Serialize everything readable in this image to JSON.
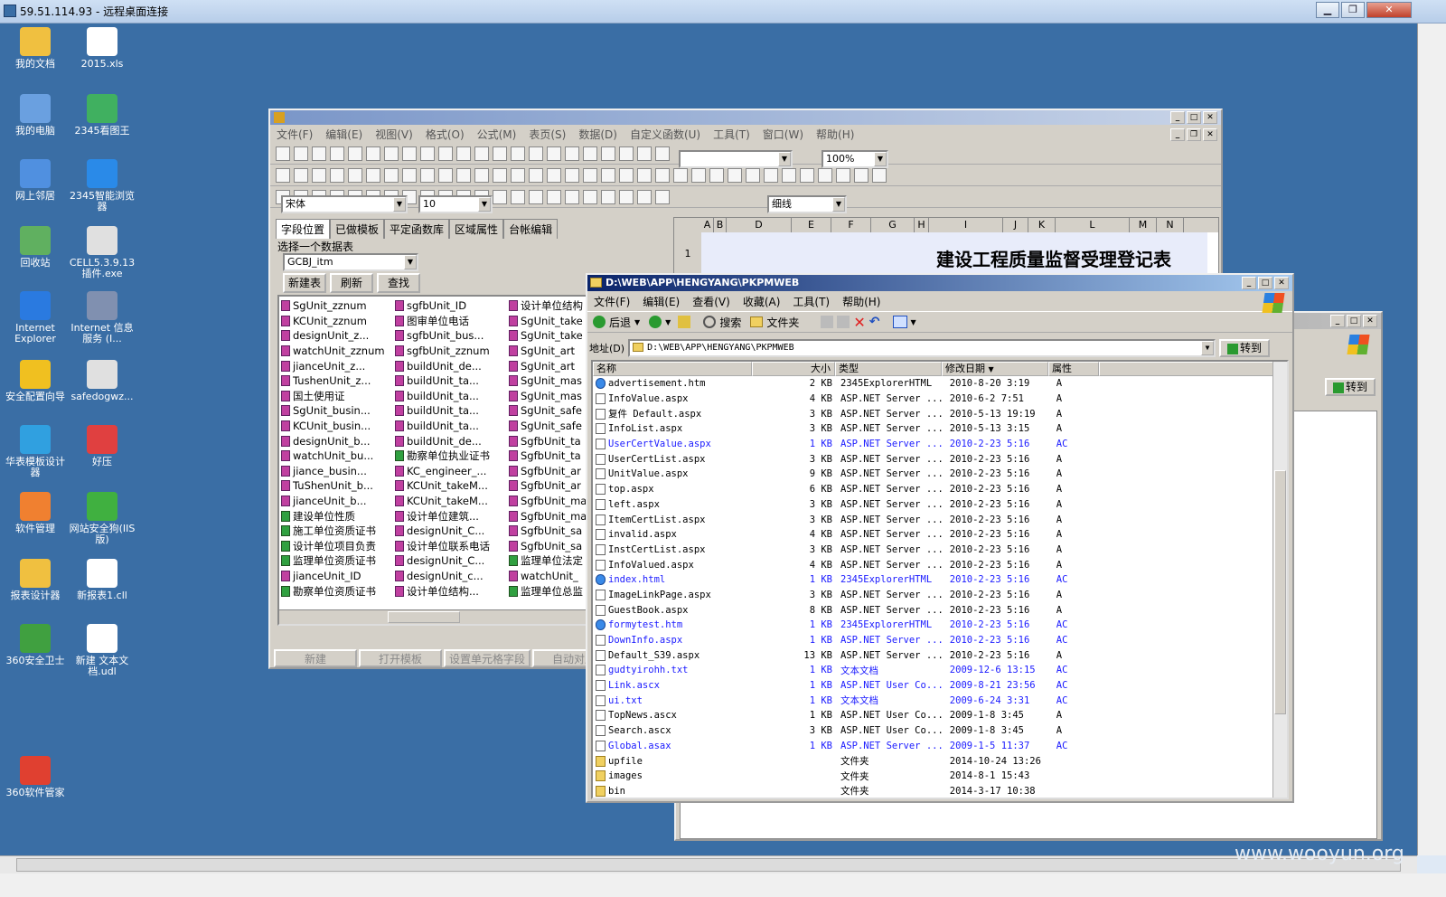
{
  "title_bar": {
    "text": "59.51.114.93 - 远程桌面连接"
  },
  "watermark": "www.wooyun.org",
  "desktop_icons": [
    {
      "label": "我的文档"
    },
    {
      "label": "2015.xls"
    },
    {
      "label": "我的电脑"
    },
    {
      "label": "2345看图王"
    },
    {
      "label": "网上邻居"
    },
    {
      "label": "2345智能浏览器"
    },
    {
      "label": "回收站"
    },
    {
      "label": "CELL5.3.9.13插件.exe"
    },
    {
      "label": "Internet Explorer"
    },
    {
      "label": "Internet 信息服务 (I..."
    },
    {
      "label": "安全配置向导"
    },
    {
      "label": "safedogwz..."
    },
    {
      "label": "华表模板设计器"
    },
    {
      "label": "好压"
    },
    {
      "label": "软件管理"
    },
    {
      "label": "网站安全狗(IIS版)"
    },
    {
      "label": "报表设计器"
    },
    {
      "label": "新报表1.cll"
    },
    {
      "label": "360安全卫士"
    },
    {
      "label": "新建 文本文档.udl"
    },
    {
      "label": "360软件管家"
    }
  ],
  "designer": {
    "menu": [
      "文件(F)",
      "编辑(E)",
      "视图(V)",
      "格式(O)",
      "公式(M)",
      "表页(S)",
      "数据(D)",
      "自定义函数(U)",
      "工具(T)",
      "窗口(W)",
      "帮助(H)"
    ],
    "zoom": "100%",
    "font_name": "宋体",
    "font_size": "10",
    "line_style": "细线",
    "tabs": [
      "字段位置",
      "已做模板",
      "平定函数库",
      "区域属性",
      "台帐编辑"
    ],
    "select_label": "选择一个数据表",
    "table_select": "GCBJ_itm",
    "buttons": {
      "new_table": "新建表",
      "refresh": "刷新",
      "find": "查找"
    },
    "col_headers": [
      "A",
      "B",
      "D",
      "E",
      "F",
      "G",
      "H",
      "I",
      "J",
      "K",
      "L",
      "M",
      "N"
    ],
    "row1": "1",
    "sheet_title": "建设工程质量监督受理登记表",
    "bottom_buttons": [
      "新建",
      "打开模板",
      "设置单元格字段",
      "自动对应"
    ],
    "fields_col1": [
      "SgUnit_zznum",
      "KCUnit_zznum",
      "designUnit_z...",
      "watchUnit_zznum",
      "jianceUnit_z...",
      "TushenUnit_z...",
      "国土使用证",
      "SgUnit_busin...",
      "KCUnit_busin...",
      "designUnit_b...",
      "watchUnit_bu...",
      "jiance_busin...",
      "TuShenUnit_b...",
      "jianceUnit_b...",
      "建设单位性质",
      "施工单位资质证书",
      "设计单位项目负责",
      "监理单位资质证书",
      "jianceUnit_ID",
      "勘察单位资质证书"
    ],
    "fields_col2": [
      "sgfbUnit_ID",
      "图审单位电话",
      "sgfbUnit_bus...",
      "sgfbUnit_zznum",
      "buildUnit_de...",
      "buildUnit_ta...",
      "buildUnit_ta...",
      "buildUnit_ta...",
      "buildUnit_ta...",
      "buildUnit_de...",
      "勘察单位执业证书",
      "KC_engineer_...",
      "KCUnit_takeM...",
      "KCUnit_takeM...",
      "设计单位建筑...",
      "designUnit_C...",
      "设计单位联系电话",
      "designUnit_C...",
      "designUnit_c...",
      "设计单位结构..."
    ],
    "fields_col3": [
      "设计单位结构",
      "SgUnit_take",
      "SgUnit_take",
      "SgUnit_art",
      "SgUnit_art",
      "SgUnit_mas",
      "SgUnit_mas",
      "SgUnit_safe",
      "SgUnit_safe",
      "SgfbUnit_ta",
      "SgfbUnit_ta",
      "SgfbUnit_ar",
      "SgfbUnit_ar",
      "SgfbUnit_ma",
      "SgfbUnit_ma",
      "SgfbUnit_sa",
      "SgfbUnit_sa",
      "监理单位法定",
      "watchUnit_",
      "监理单位总监"
    ]
  },
  "explorer": {
    "title": "D:\\WEB\\APP\\HENGYANG\\PKPMWEB",
    "menu": [
      "文件(F)",
      "编辑(E)",
      "查看(V)",
      "收藏(A)",
      "工具(T)",
      "帮助(H)"
    ],
    "back": "后退",
    "search": "搜索",
    "folders": "文件夹",
    "address_label": "地址(D)",
    "address": "D:\\WEB\\APP\\HENGYANG\\PKPMWEB",
    "go": "转到",
    "columns": [
      "名称",
      "大小",
      "类型",
      "修改日期",
      "属性"
    ],
    "files": [
      {
        "name": "advertisement.htm",
        "size": "2 KB",
        "type": "2345ExplorerHTML",
        "date": "2010-8-20 3:19",
        "attr": "A",
        "blue": false,
        "icon": "web"
      },
      {
        "name": "InfoValue.aspx",
        "size": "4 KB",
        "type": "ASP.NET Server ...",
        "date": "2010-6-2 7:51",
        "attr": "A",
        "blue": false,
        "icon": "doc"
      },
      {
        "name": "复件 Default.aspx",
        "size": "3 KB",
        "type": "ASP.NET Server ...",
        "date": "2010-5-13 19:19",
        "attr": "A",
        "blue": false,
        "icon": "doc"
      },
      {
        "name": "InfoList.aspx",
        "size": "3 KB",
        "type": "ASP.NET Server ...",
        "date": "2010-5-13 3:15",
        "attr": "A",
        "blue": false,
        "icon": "doc"
      },
      {
        "name": "UserCertValue.aspx",
        "size": "1 KB",
        "type": "ASP.NET Server ...",
        "date": "2010-2-23 5:16",
        "attr": "AC",
        "blue": true,
        "icon": "doc"
      },
      {
        "name": "UserCertList.aspx",
        "size": "3 KB",
        "type": "ASP.NET Server ...",
        "date": "2010-2-23 5:16",
        "attr": "A",
        "blue": false,
        "icon": "doc"
      },
      {
        "name": "UnitValue.aspx",
        "size": "9 KB",
        "type": "ASP.NET Server ...",
        "date": "2010-2-23 5:16",
        "attr": "A",
        "blue": false,
        "icon": "doc"
      },
      {
        "name": "top.aspx",
        "size": "6 KB",
        "type": "ASP.NET Server ...",
        "date": "2010-2-23 5:16",
        "attr": "A",
        "blue": false,
        "icon": "doc"
      },
      {
        "name": "left.aspx",
        "size": "3 KB",
        "type": "ASP.NET Server ...",
        "date": "2010-2-23 5:16",
        "attr": "A",
        "blue": false,
        "icon": "doc"
      },
      {
        "name": "ItemCertList.aspx",
        "size": "3 KB",
        "type": "ASP.NET Server ...",
        "date": "2010-2-23 5:16",
        "attr": "A",
        "blue": false,
        "icon": "doc"
      },
      {
        "name": "invalid.aspx",
        "size": "4 KB",
        "type": "ASP.NET Server ...",
        "date": "2010-2-23 5:16",
        "attr": "A",
        "blue": false,
        "icon": "doc"
      },
      {
        "name": "InstCertList.aspx",
        "size": "3 KB",
        "type": "ASP.NET Server ...",
        "date": "2010-2-23 5:16",
        "attr": "A",
        "blue": false,
        "icon": "doc"
      },
      {
        "name": "InfoValued.aspx",
        "size": "4 KB",
        "type": "ASP.NET Server ...",
        "date": "2010-2-23 5:16",
        "attr": "A",
        "blue": false,
        "icon": "doc"
      },
      {
        "name": "index.html",
        "size": "1 KB",
        "type": "2345ExplorerHTML",
        "date": "2010-2-23 5:16",
        "attr": "AC",
        "blue": true,
        "icon": "web"
      },
      {
        "name": "ImageLinkPage.aspx",
        "size": "3 KB",
        "type": "ASP.NET Server ...",
        "date": "2010-2-23 5:16",
        "attr": "A",
        "blue": false,
        "icon": "doc"
      },
      {
        "name": "GuestBook.aspx",
        "size": "8 KB",
        "type": "ASP.NET Server ...",
        "date": "2010-2-23 5:16",
        "attr": "A",
        "blue": false,
        "icon": "doc"
      },
      {
        "name": "formytest.htm",
        "size": "1 KB",
        "type": "2345ExplorerHTML",
        "date": "2010-2-23 5:16",
        "attr": "AC",
        "blue": true,
        "icon": "web"
      },
      {
        "name": "DownInfo.aspx",
        "size": "1 KB",
        "type": "ASP.NET Server ...",
        "date": "2010-2-23 5:16",
        "attr": "AC",
        "blue": true,
        "icon": "doc"
      },
      {
        "name": "Default_S39.aspx",
        "size": "13 KB",
        "type": "ASP.NET Server ...",
        "date": "2010-2-23 5:16",
        "attr": "A",
        "blue": false,
        "icon": "doc"
      },
      {
        "name": "gudtyirohh.txt",
        "size": "1 KB",
        "type": "文本文档",
        "date": "2009-12-6 13:15",
        "attr": "AC",
        "blue": true,
        "icon": "doc"
      },
      {
        "name": "Link.ascx",
        "size": "1 KB",
        "type": "ASP.NET User Co...",
        "date": "2009-8-21 23:56",
        "attr": "AC",
        "blue": true,
        "icon": "doc"
      },
      {
        "name": "ui.txt",
        "size": "1 KB",
        "type": "文本文档",
        "date": "2009-6-24 3:31",
        "attr": "AC",
        "blue": true,
        "icon": "doc"
      },
      {
        "name": "TopNews.ascx",
        "size": "1 KB",
        "type": "ASP.NET User Co...",
        "date": "2009-1-8 3:45",
        "attr": "A",
        "blue": false,
        "icon": "doc"
      },
      {
        "name": "Search.ascx",
        "size": "3 KB",
        "type": "ASP.NET User Co...",
        "date": "2009-1-8 3:45",
        "attr": "A",
        "blue": false,
        "icon": "doc"
      },
      {
        "name": "Global.asax",
        "size": "1 KB",
        "type": "ASP.NET Server ...",
        "date": "2009-1-5 11:37",
        "attr": "AC",
        "blue": true,
        "icon": "doc"
      },
      {
        "name": "upfile",
        "size": "",
        "type": "文件夹",
        "date": "2014-10-24 13:26",
        "attr": "",
        "blue": false,
        "icon": "folder"
      },
      {
        "name": "images",
        "size": "",
        "type": "文件夹",
        "date": "2014-8-1 15:43",
        "attr": "",
        "blue": false,
        "icon": "folder"
      },
      {
        "name": "bin",
        "size": "",
        "type": "文件夹",
        "date": "2014-3-17 10:38",
        "attr": "",
        "blue": false,
        "icon": "folder"
      }
    ]
  },
  "back_window": {
    "go": "转到"
  }
}
